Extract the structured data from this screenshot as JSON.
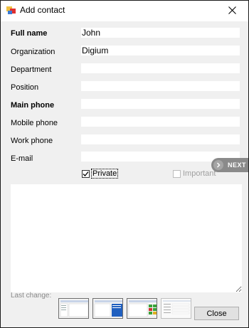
{
  "window": {
    "title": "Add contact"
  },
  "form": {
    "fields": [
      {
        "label": "Full name",
        "value": "John",
        "bold": true
      },
      {
        "label": "Organization",
        "value": "Digium",
        "bold": false
      },
      {
        "label": "Department",
        "value": "",
        "bold": false
      },
      {
        "label": "Position",
        "value": "",
        "bold": false
      },
      {
        "label": "Main phone",
        "value": "",
        "bold": true
      },
      {
        "label": "Mobile phone",
        "value": "",
        "bold": false
      },
      {
        "label": "Work phone",
        "value": "",
        "bold": false
      },
      {
        "label": "E-mail",
        "value": "",
        "bold": false
      }
    ],
    "private": {
      "label": "Private",
      "checked": true
    },
    "important": {
      "label": "Important",
      "checked": false,
      "enabled": false
    },
    "next_label": "NEXT",
    "notes_value": ""
  },
  "footer": {
    "last_change_label": "Last change:",
    "close_label": "Close"
  },
  "colors": {
    "background": "#f0f0f0",
    "next_button": "#8a8a8a",
    "accent_thumb_blue": "#1f5fbf"
  }
}
